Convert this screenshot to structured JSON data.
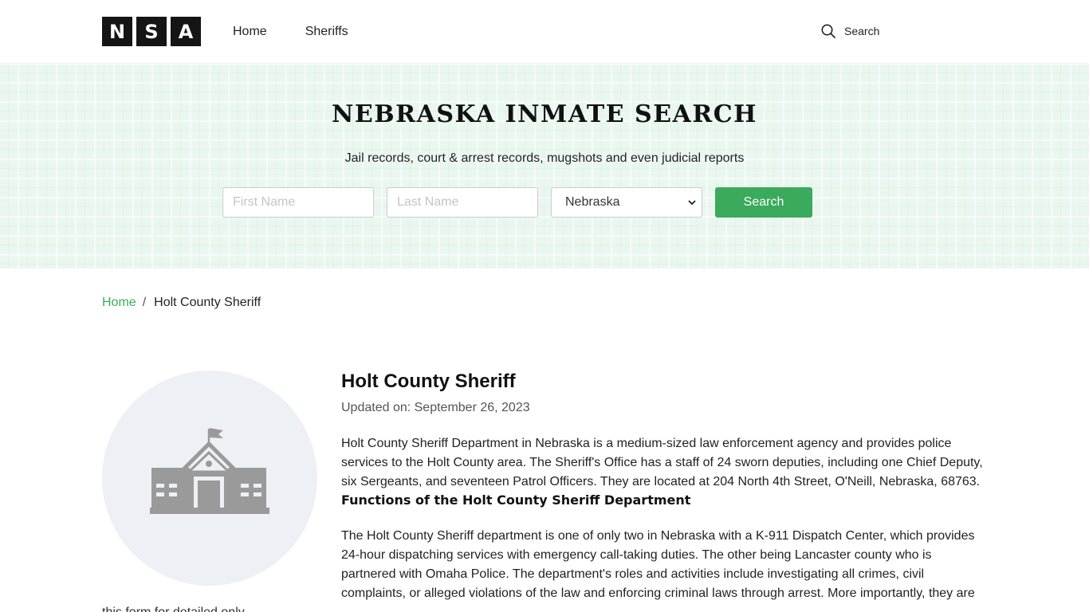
{
  "header": {
    "logo_letters": [
      "N",
      "S",
      "A"
    ],
    "nav": [
      {
        "label": "Home"
      },
      {
        "label": "Sheriffs"
      }
    ],
    "search_label": "Search"
  },
  "hero": {
    "title": "NEBRASKA INMATE SEARCH",
    "subtitle": "Jail records, court & arrest records, mugshots and even judicial reports",
    "first_name_placeholder": "First Name",
    "last_name_placeholder": "Last Name",
    "state_selected": "Nebraska",
    "search_button": "Search"
  },
  "breadcrumb": {
    "home": "Home",
    "separator": "/",
    "current": "Holt County Sheriff"
  },
  "main": {
    "title": "Holt County Sheriff",
    "updated": "Updated on: September 26, 2023",
    "paragraph_1": "Holt County Sheriff Department in Nebraska is a medium-sized law enforcement agency and provides police services to the Holt County area. The Sheriff's Office has a staff of 24 sworn deputies, including one Chief Deputy, six Sergeants, and seventeen Patrol Officers. They are located at 204 North 4th Street, O'Neill, Nebraska, 68763.",
    "section_heading": "Functions of the Holt County Sheriff Department",
    "paragraph_2": "The Holt County Sheriff department is one of only two in Nebraska with a K-911 Dispatch Center, which provides 24-hour dispatching services with emergency call-taking duties. The other being Lancaster county who is partnered with Omaha Police. The department's roles and activities include investigating all crimes, civil complaints, or alleged violations of the law and enforcing criminal laws through arrest. More importantly, they are",
    "left_caption": "this form for detailed only",
    "icon": "courthouse-icon"
  },
  "colors": {
    "accent": "#3aaa5c",
    "hero_bg": "#eaf7ef",
    "logo_bg": "#151515",
    "avatar_bg": "#edf1f5",
    "icon_gray": "#9a9a9a"
  }
}
